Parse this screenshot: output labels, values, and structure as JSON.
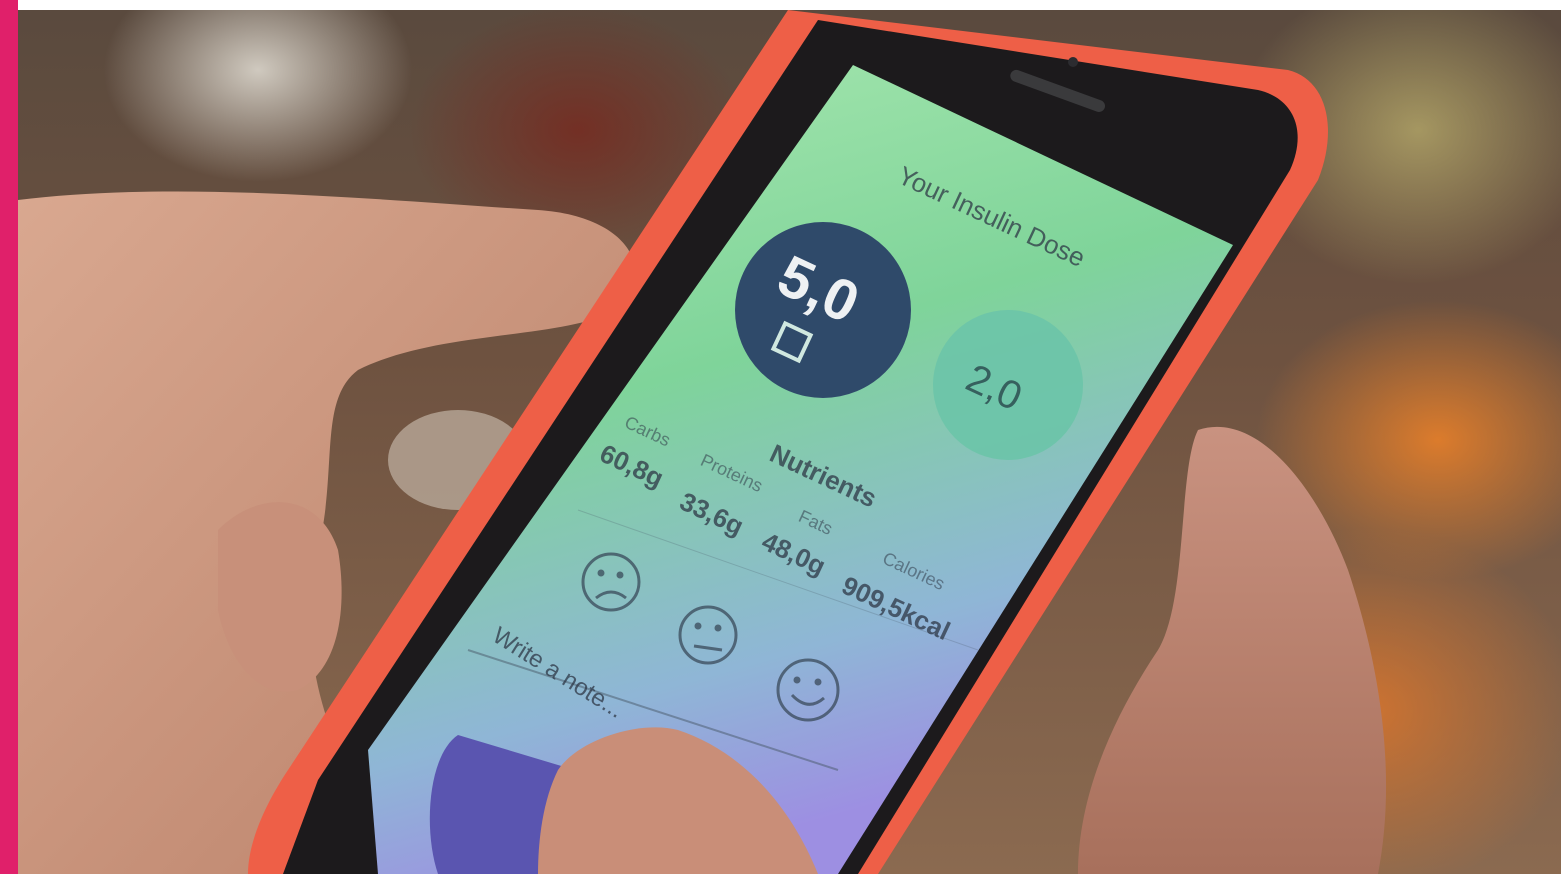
{
  "screen": {
    "title": "Your Insulin Dose",
    "main_dose": "5,0",
    "secondary_dose": "2,0",
    "nutrients_title": "Nutrients",
    "nutrients": [
      {
        "label": "Carbs",
        "value": "60,8g"
      },
      {
        "label": "Proteins",
        "value": "33,6g"
      },
      {
        "label": "Fats",
        "value": "48,0g"
      },
      {
        "label": "Calories",
        "value": "909,5kcal"
      }
    ],
    "note_placeholder": "Write a note..."
  },
  "colors": {
    "accent_bar": "#e0206a",
    "phone_case": "#f0604a",
    "screen_gradient_top": "#9fe0a8",
    "screen_gradient_bottom": "#9a90e0",
    "dose_circle_main": "#2f4a6a",
    "dose_circle_secondary": "#6cc4a8",
    "button": "#5a55b0"
  }
}
